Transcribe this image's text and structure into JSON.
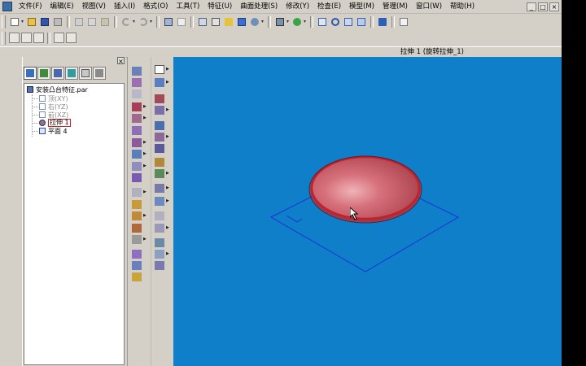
{
  "app": {
    "menu": [
      "文件(F)",
      "编辑(E)",
      "视图(V)",
      "插入(I)",
      "格式(O)",
      "工具(T)",
      "特征(U)",
      "曲面处理(S)",
      "修改(Y)",
      "检查(E)",
      "模型(M)",
      "管理(M)",
      "窗口(W)",
      "帮助(H)"
    ],
    "window_buttons": [
      "_",
      "□",
      "×"
    ]
  },
  "status": {
    "feature_prompt": "拉伸 1 (旋转拉伸_1)"
  },
  "pathfinder": {
    "close_label": "×",
    "tree": {
      "root": "安装凸台特征.par",
      "items": [
        {
          "label": "顶(XY)",
          "state": "hidden"
        },
        {
          "label": "右(YZ)",
          "state": "hidden"
        },
        {
          "label": "前(XZ)",
          "state": "hidden"
        },
        {
          "label": "拉伸 1",
          "state": "selected"
        },
        {
          "label": "平面 4",
          "state": "normal"
        }
      ]
    }
  },
  "colors": {
    "viewport_bg": "#0f7fc9",
    "body_fill": "#c45a63",
    "body_edge": "#c41f2a",
    "plane_edge": "#1b33d6",
    "chrome": "#d4d0c8"
  },
  "icons": {
    "toolbar1": [
      "new-icon",
      "open-icon",
      "save-icon",
      "print-icon",
      "cut-icon",
      "copy-icon",
      "paste-icon",
      "undo-icon",
      "redo-icon",
      "layout-icon",
      "sketch-icon",
      "view-cube-icon",
      "shade-icon",
      "render-icon",
      "display-icon",
      "settings-icon",
      "zoom-area-icon",
      "zoom-icon",
      "fit-icon",
      "pan-icon",
      "help-icon",
      "window-icon"
    ],
    "pathfinder_tabs": [
      "feature-tree-icon",
      "layers-icon",
      "sensor-icon",
      "library-icon",
      "family-icon",
      "properties-icon"
    ]
  }
}
